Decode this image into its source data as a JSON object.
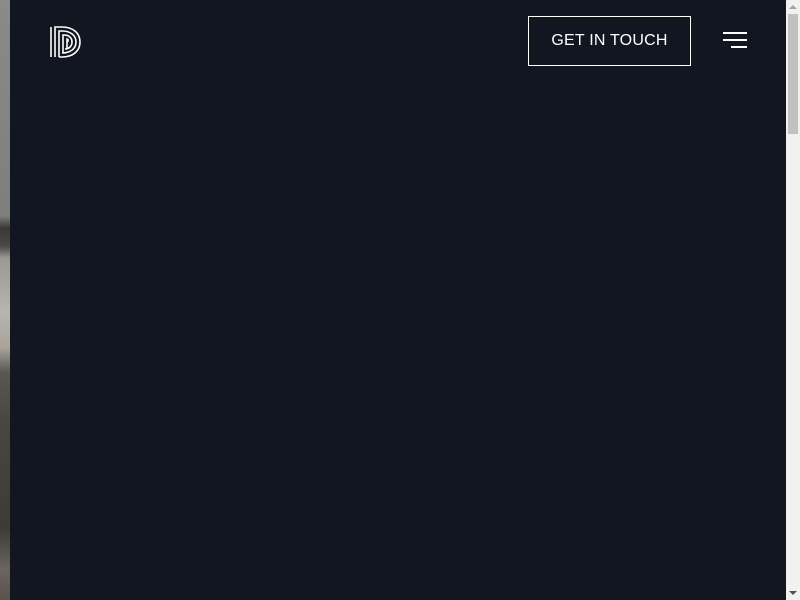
{
  "header": {
    "logo_icon": "brand-d-logo-icon",
    "cta_label": "GET IN TOUCH",
    "menu_icon": "hamburger-menu-icon"
  },
  "colors": {
    "background": "#111620",
    "foreground": "#ffffff",
    "scrollbar_track": "#f1f1f1",
    "scrollbar_thumb": "#c1c1c1"
  }
}
